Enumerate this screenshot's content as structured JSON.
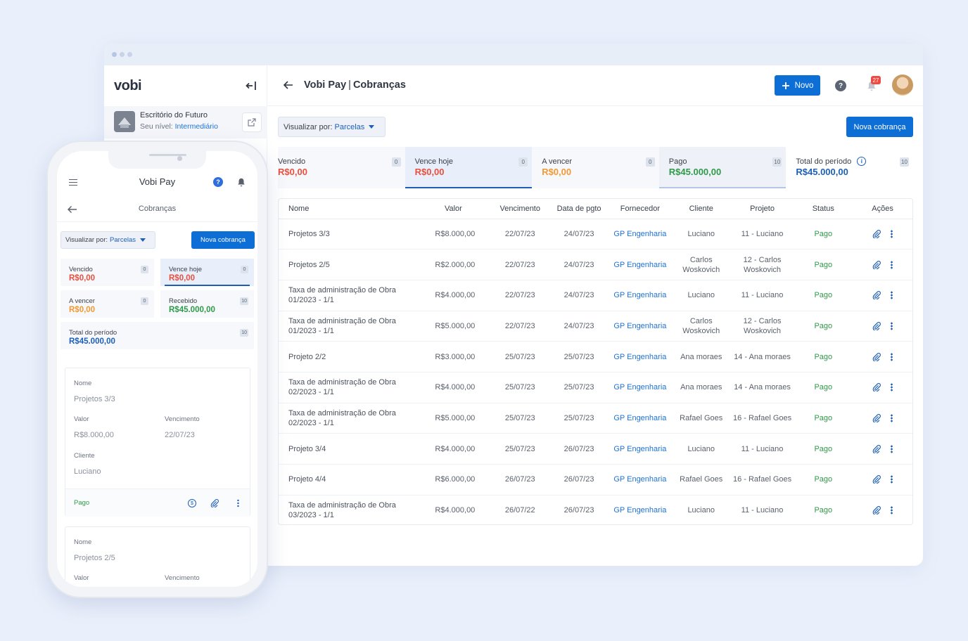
{
  "colors": {
    "primary": "#0d6ed6",
    "link": "#1d72d8",
    "red": "#e94f3d",
    "orange": "#f29933",
    "green": "#2f9a49",
    "badge": "#ee4b44"
  },
  "sidebar": {
    "logo": "vobi",
    "org_name": "Escritório do Futuro",
    "level_label": "Seu nível:",
    "level_value": "Intermediário"
  },
  "header": {
    "title": "Vobi Pay",
    "subtitle": "Cobranças",
    "new_button": "Novo",
    "notification_count": "27"
  },
  "toolbar": {
    "view_label": "Visualizar por:",
    "view_value": "Parcelas",
    "new_charge_button": "Nova cobrança"
  },
  "summary_cards": [
    {
      "label": "Vencido",
      "value": "R$0,00",
      "count": "0"
    },
    {
      "label": "Vence hoje",
      "value": "R$0,00",
      "count": "0"
    },
    {
      "label": "A vencer",
      "value": "R$0,00",
      "count": "0"
    },
    {
      "label": "Pago",
      "value": "R$45.000,00",
      "count": "10"
    },
    {
      "label": "Total do período",
      "value": "R$45.000,00",
      "count": "10"
    }
  ],
  "table": {
    "headers": [
      "Nome",
      "Valor",
      "Vencimento",
      "Data de pgto",
      "Fornecedor",
      "Cliente",
      "Projeto",
      "Status",
      "Ações"
    ],
    "rows": [
      {
        "nome": "Projetos 3/3",
        "valor": "R$8.000,00",
        "vencimento": "22/07/23",
        "pgto": "24/07/23",
        "fornecedor": "GP Engenharia",
        "cliente": "Luciano",
        "projeto": "11 - Luciano",
        "status": "Pago"
      },
      {
        "nome": "Projetos 2/5",
        "valor": "R$2.000,00",
        "vencimento": "22/07/23",
        "pgto": "24/07/23",
        "fornecedor": "GP Engenharia",
        "cliente": "Carlos Woskovich",
        "projeto": "12 - Carlos Woskovich",
        "status": "Pago"
      },
      {
        "nome": "Taxa de administração de Obra 01/2023 - 1/1",
        "valor": "R$4.000,00",
        "vencimento": "22/07/23",
        "pgto": "24/07/23",
        "fornecedor": "GP Engenharia",
        "cliente": "Luciano",
        "projeto": "11 - Luciano",
        "status": "Pago"
      },
      {
        "nome": "Taxa de administração de Obra 01/2023 - 1/1",
        "valor": "R$5.000,00",
        "vencimento": "22/07/23",
        "pgto": "24/07/23",
        "fornecedor": "GP Engenharia",
        "cliente": "Carlos Woskovich",
        "projeto": "12 - Carlos Woskovich",
        "status": "Pago"
      },
      {
        "nome": "Projeto 2/2",
        "valor": "R$3.000,00",
        "vencimento": "25/07/23",
        "pgto": "25/07/23",
        "fornecedor": "GP Engenharia",
        "cliente": "Ana moraes",
        "projeto": "14 - Ana moraes",
        "status": "Pago"
      },
      {
        "nome": "Taxa de administração de Obra 02/2023 - 1/1",
        "valor": "R$4.000,00",
        "vencimento": "25/07/23",
        "pgto": "25/07/23",
        "fornecedor": "GP Engenharia",
        "cliente": "Ana moraes",
        "projeto": "14 - Ana moraes",
        "status": "Pago"
      },
      {
        "nome": "Taxa de administração de Obra 02/2023 - 1/1",
        "valor": "R$5.000,00",
        "vencimento": "25/07/23",
        "pgto": "25/07/23",
        "fornecedor": "GP Engenharia",
        "cliente": "Rafael Goes",
        "projeto": "16 - Rafael Goes",
        "status": "Pago"
      },
      {
        "nome": "Projeto 3/4",
        "valor": "R$4.000,00",
        "vencimento": "25/07/23",
        "pgto": "26/07/23",
        "fornecedor": "GP Engenharia",
        "cliente": "Luciano",
        "projeto": "11 - Luciano",
        "status": "Pago"
      },
      {
        "nome": "Projeto 4/4",
        "valor": "R$6.000,00",
        "vencimento": "26/07/23",
        "pgto": "26/07/23",
        "fornecedor": "GP Engenharia",
        "cliente": "Rafael Goes",
        "projeto": "16 - Rafael Goes",
        "status": "Pago"
      },
      {
        "nome": "Taxa de administração de Obra 03/2023 - 1/1",
        "valor": "R$4.000,00",
        "vencimento": "26/07/22",
        "pgto": "26/07/23",
        "fornecedor": "GP Engenharia",
        "cliente": "Luciano",
        "projeto": "11 - Luciano",
        "status": "Pago"
      }
    ]
  },
  "mobile": {
    "title": "Vobi Pay",
    "subtitle": "Cobranças",
    "view_label": "Visualizar por:",
    "view_value": "Parcelas",
    "new_charge_button": "Nova cobrança",
    "cards": [
      {
        "label": "Vencido",
        "value": "R$0,00",
        "count": "0"
      },
      {
        "label": "Vence hoje",
        "value": "R$0,00",
        "count": "0"
      },
      {
        "label": "A vencer",
        "value": "R$0,00",
        "count": "0"
      },
      {
        "label": "Recebido",
        "value": "R$45.000,00",
        "count": "10"
      },
      {
        "label": "Total do período",
        "value": "R$45.000,00",
        "count": "10"
      }
    ],
    "items": [
      {
        "nome_label": "Nome",
        "nome": "Projetos 3/3",
        "valor_label": "Valor",
        "valor": "R$8.000,00",
        "venc_label": "Vencimento",
        "venc": "22/07/23",
        "cliente_label": "Cliente",
        "cliente": "Luciano",
        "status": "Pago"
      },
      {
        "nome_label": "Nome",
        "nome": "Projetos 2/5",
        "valor_label": "Valor",
        "venc_label": "Vencimento"
      }
    ]
  }
}
